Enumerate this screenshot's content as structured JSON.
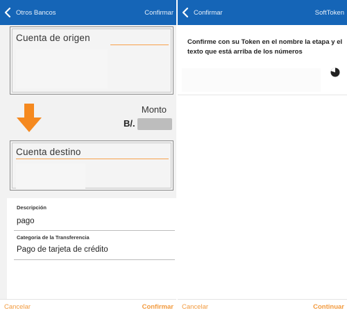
{
  "left": {
    "header": {
      "back_label": "Otros Bancos",
      "right_label": "Confirmar"
    },
    "origin": {
      "title": "Cuenta de origen"
    },
    "amount": {
      "label": "Monto",
      "currency": "B/."
    },
    "destination": {
      "title": "Cuenta destino"
    },
    "description": {
      "label": "Descripción",
      "value": "pago"
    },
    "category": {
      "label": "Categoria de la Transferencia",
      "value": "Pago de tarjeta de crédito"
    },
    "footer": {
      "cancel": "Cancelar",
      "confirm": "Confirmar"
    }
  },
  "right": {
    "header": {
      "back_label": "Confirmar",
      "right_label": "SoftToken"
    },
    "instruction": "Confirme con su Token en el nombre la etapa y el texto que está arriba de los números",
    "footer": {
      "cancel": "Cancelar",
      "continue": "Continuar"
    }
  },
  "colors": {
    "header_bg": "#1565b7",
    "accent_orange": "#f29a3e",
    "arrow_orange": "#f5891f"
  },
  "icons": [
    "chevron-left-icon",
    "down-arrow-icon",
    "loading-spinner-icon"
  ]
}
